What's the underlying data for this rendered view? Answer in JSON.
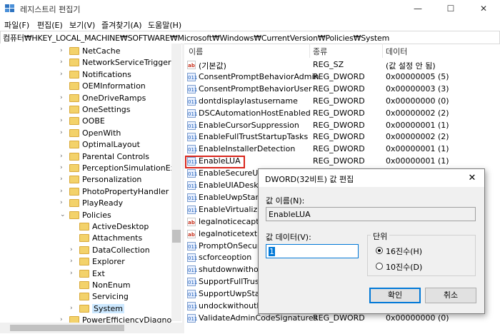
{
  "window": {
    "title": "레지스트리 편집기",
    "minimize": "—",
    "maximize": "☐",
    "close": "✕"
  },
  "menu": [
    "파일(F)",
    "편집(E)",
    "보기(V)",
    "즐겨찾기(A)",
    "도움말(H)"
  ],
  "address": "컴퓨터₩HKEY_LOCAL_MACHINE₩SOFTWARE₩Microsoft₩Windows₩CurrentVersion₩Policies₩System",
  "tree": [
    {
      "label": "NetCache",
      "level": 0,
      "expand": "›"
    },
    {
      "label": "NetworkServiceTriggers",
      "level": 0,
      "expand": "›"
    },
    {
      "label": "Notifications",
      "level": 0,
      "expand": "›"
    },
    {
      "label": "OEMInformation",
      "level": 0,
      "expand": ""
    },
    {
      "label": "OneDriveRamps",
      "level": 0,
      "expand": "›"
    },
    {
      "label": "OneSettings",
      "level": 0,
      "expand": "›"
    },
    {
      "label": "OOBE",
      "level": 0,
      "expand": "›"
    },
    {
      "label": "OpenWith",
      "level": 0,
      "expand": "›"
    },
    {
      "label": "OptimalLayout",
      "level": 0,
      "expand": ""
    },
    {
      "label": "Parental Controls",
      "level": 0,
      "expand": "›"
    },
    {
      "label": "PerceptionSimulationExter",
      "level": 0,
      "expand": "›"
    },
    {
      "label": "Personalization",
      "level": 0,
      "expand": "›"
    },
    {
      "label": "PhotoPropertyHandler",
      "level": 0,
      "expand": "›"
    },
    {
      "label": "PlayReady",
      "level": 0,
      "expand": "›"
    },
    {
      "label": "Policies",
      "level": 0,
      "expand": "⌄"
    },
    {
      "label": "ActiveDesktop",
      "level": 1,
      "expand": ""
    },
    {
      "label": "Attachments",
      "level": 1,
      "expand": ""
    },
    {
      "label": "DataCollection",
      "level": 1,
      "expand": "›"
    },
    {
      "label": "Explorer",
      "level": 1,
      "expand": "›"
    },
    {
      "label": "Ext",
      "level": 1,
      "expand": "›"
    },
    {
      "label": "NonEnum",
      "level": 1,
      "expand": ""
    },
    {
      "label": "Servicing",
      "level": 1,
      "expand": ""
    },
    {
      "label": "System",
      "level": 1,
      "expand": "›",
      "selected": true
    },
    {
      "label": "PowerEfficiencyDiagnostic",
      "level": 0,
      "expand": "›"
    }
  ],
  "list": {
    "columns": [
      "이름",
      "종류",
      "데이터"
    ],
    "rows": [
      {
        "name": "(기본값)",
        "type": "REG_SZ",
        "data": "(값 설정 안 됨)",
        "icon": "ab"
      },
      {
        "name": "ConsentPromptBehaviorAdmin",
        "type": "REG_DWORD",
        "data": "0x00000005 (5)",
        "icon": "011"
      },
      {
        "name": "ConsentPromptBehaviorUser",
        "type": "REG_DWORD",
        "data": "0x00000003 (3)",
        "icon": "011"
      },
      {
        "name": "dontdisplaylastusername",
        "type": "REG_DWORD",
        "data": "0x00000000 (0)",
        "icon": "011"
      },
      {
        "name": "DSCAutomationHostEnabled",
        "type": "REG_DWORD",
        "data": "0x00000002 (2)",
        "icon": "011"
      },
      {
        "name": "EnableCursorSuppression",
        "type": "REG_DWORD",
        "data": "0x00000001 (1)",
        "icon": "011"
      },
      {
        "name": "EnableFullTrustStartupTasks",
        "type": "REG_DWORD",
        "data": "0x00000002 (2)",
        "icon": "011"
      },
      {
        "name": "EnableInstallerDetection",
        "type": "REG_DWORD",
        "data": "0x00000001 (1)",
        "icon": "011"
      },
      {
        "name": "EnableLUA",
        "type": "REG_DWORD",
        "data": "0x00000001 (1)",
        "icon": "011"
      },
      {
        "name": "EnableSecureUIAP",
        "type": "",
        "data": "",
        "icon": "011"
      },
      {
        "name": "EnableUIADesktop",
        "type": "",
        "data": "",
        "icon": "011"
      },
      {
        "name": "EnableUwpStartup",
        "type": "",
        "data": "",
        "icon": "011"
      },
      {
        "name": "EnableVirtualizatio",
        "type": "",
        "data": "",
        "icon": "011"
      },
      {
        "name": "legalnoticecaption",
        "type": "",
        "data": "",
        "icon": "ab"
      },
      {
        "name": "legalnoticetext",
        "type": "",
        "data": "",
        "icon": "ab"
      },
      {
        "name": "PromptOnSecureDe",
        "type": "",
        "data": "",
        "icon": "011"
      },
      {
        "name": "scforceoption",
        "type": "",
        "data": "",
        "icon": "011"
      },
      {
        "name": "shutdownwithout",
        "type": "",
        "data": "",
        "icon": "011"
      },
      {
        "name": "SupportFullTrustS",
        "type": "",
        "data": "",
        "icon": "011"
      },
      {
        "name": "SupportUwpStartu",
        "type": "",
        "data": "",
        "icon": "011"
      },
      {
        "name": "undockwithoutlog",
        "type": "",
        "data": "",
        "icon": "011"
      },
      {
        "name": "ValidateAdminCodeSignatures",
        "type": "REG_DWORD",
        "data": "0x00000000 (0)",
        "icon": "011"
      }
    ]
  },
  "dialog": {
    "title": "DWORD(32비트) 값 편집",
    "close": "✕",
    "name_label": "값 이름(N):",
    "name_value": "EnableLUA",
    "data_label": "값 데이터(V):",
    "data_value": "1",
    "base_label": "단위",
    "hex_label": "16진수(H)",
    "dec_label": "10진수(D)",
    "base_selected": "16진수(H)",
    "ok": "확인",
    "cancel": "취소"
  }
}
